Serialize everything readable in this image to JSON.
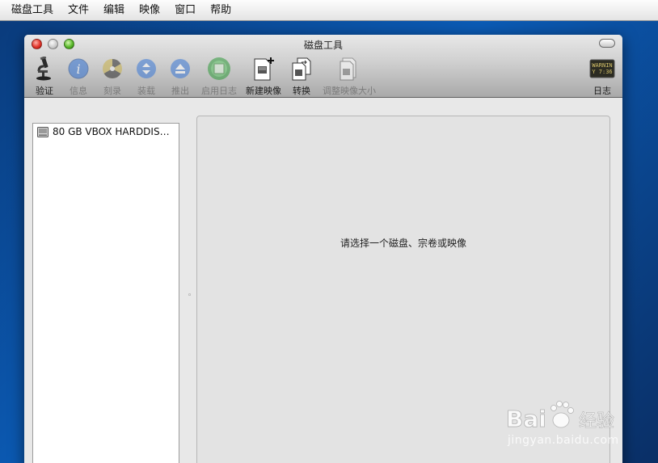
{
  "menubar": {
    "items": [
      "磁盘工具",
      "文件",
      "编辑",
      "映像",
      "窗口",
      "帮助"
    ]
  },
  "window": {
    "title": "磁盘工具"
  },
  "toolbar": {
    "verify": "验证",
    "info": "信息",
    "burn": "刻录",
    "mount": "装载",
    "eject": "推出",
    "enable_journal": "启用日志",
    "new_image": "新建映像",
    "convert": "转换",
    "resize_image": "调整映像大小",
    "log": "日志",
    "log_icon_text": "WARNIN\nY 7:36"
  },
  "sidebar": {
    "items": [
      {
        "label": "80 GB VBOX HARDDISK ...",
        "icon": "hard-disk-icon"
      }
    ]
  },
  "main": {
    "placeholder": "请选择一个磁盘、宗卷或映像"
  },
  "watermark": {
    "brand": "Bai",
    "suffix": "经验",
    "url": "jingyan.baidu.com"
  }
}
